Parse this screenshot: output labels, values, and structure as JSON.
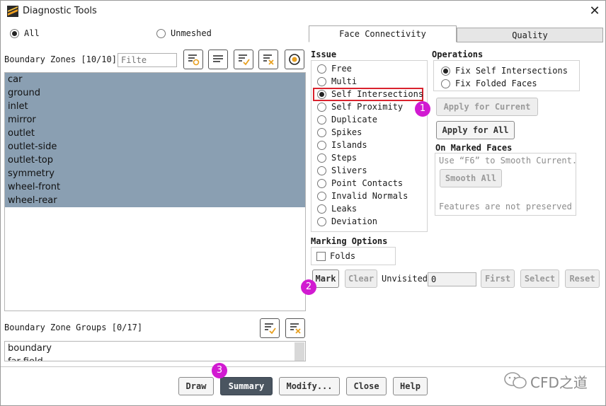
{
  "window": {
    "title": "Diagnostic Tools"
  },
  "mesh_filter": {
    "all_label": "All",
    "unmeshed_label": "Unmeshed",
    "selected": "All"
  },
  "boundary_zones": {
    "label": "Boundary Zones [10/10]",
    "filter_placeholder": "Filte",
    "items": [
      "car",
      "ground",
      "inlet",
      "mirror",
      "outlet",
      "outlet-side",
      "outlet-top",
      "symmetry",
      "wheel-front",
      "wheel-rear"
    ]
  },
  "boundary_zone_groups": {
    "label": "Boundary Zone Groups [0/17]",
    "items": [
      "boundary",
      "far-field"
    ]
  },
  "tabs": [
    "Face Connectivity",
    "Quality"
  ],
  "issue": {
    "heading": "Issue",
    "options": [
      "Free",
      "Multi",
      "Self Intersections",
      "Self Proximity",
      "Duplicate",
      "Spikes",
      "Islands",
      "Steps",
      "Slivers",
      "Point Contacts",
      "Invalid Normals",
      "Leaks",
      "Deviation"
    ],
    "selected": "Self Intersections"
  },
  "operations": {
    "heading": "Operations",
    "options": [
      "Fix Self Intersections",
      "Fix Folded Faces"
    ],
    "selected": "Fix Self Intersections",
    "apply_current_label": "Apply for Current",
    "apply_all_label": "Apply for All"
  },
  "on_marked_faces": {
    "heading": "On Marked Faces",
    "hint": "Use “F6” to Smooth Current.",
    "smooth_all_label": "Smooth All",
    "note": "Features are not preserved"
  },
  "marking_options": {
    "heading": "Marking Options",
    "folds_label": "Folds"
  },
  "mark_row": {
    "mark_label": "Mark",
    "clear_label": "Clear",
    "unvisited_label": "Unvisited",
    "unvisited_value": "0",
    "first_label": "First",
    "select_label": "Select",
    "reset_label": "Reset"
  },
  "footer": {
    "draw_label": "Draw",
    "summary_label": "Summary",
    "modify_label": "Modify...",
    "close_label": "Close",
    "help_label": "Help"
  },
  "annotations": {
    "badge1": "1",
    "badge2": "2",
    "badge3": "3"
  },
  "watermark": "CFD之道",
  "colors": {
    "selection": "#8a9fb2",
    "highlight_box": "#d9232e",
    "badge": "#d11ad1",
    "primary_button": "#4a5560"
  }
}
